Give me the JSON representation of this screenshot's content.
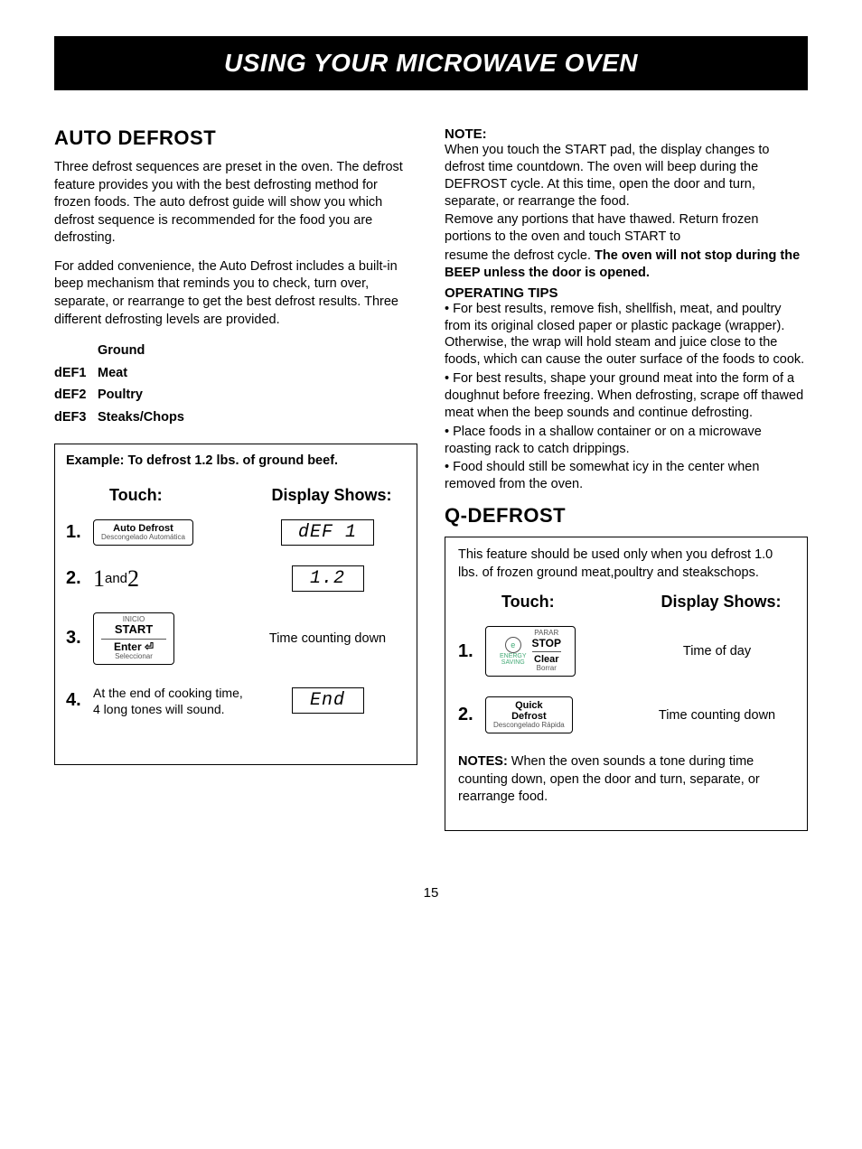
{
  "banner": "USING YOUR MICROWAVE OVEN",
  "left": {
    "h": "AUTO DEFROST",
    "p1": "Three defrost sequences are preset in the oven. The defrost feature provides you with the best defrosting method for frozen foods. The auto defrost guide will show you which defrost sequence is recommended for the food you are defrosting.",
    "p2": "For added convenience, the Auto Defrost includes a built-in beep mechanism that reminds you to check, turn over, separate, or rearrange to get the best defrost results. Three different defrosting levels are provided.",
    "def1c": "dEF1",
    "def1l": "Ground Meat",
    "def2c": "dEF2",
    "def2l": "Poultry",
    "def3c": "dEF3",
    "def3l": "Steaks/Chops",
    "example_title": "Example: To defrost 1.2 lbs. of ground beef.",
    "touch_h": "Touch:",
    "disp_h": "Display Shows:",
    "s1n": "1.",
    "s1_btn_main": "Auto Defrost",
    "s1_btn_sub": "Descongelado Automática",
    "s1_disp": "dEF 1",
    "s2n": "2.",
    "s2_touch_a": "1",
    "s2_touch_mid": " and ",
    "s2_touch_b": "2",
    "s2_disp": "1.2",
    "s3n": "3.",
    "s3_btn_top": "INICIO",
    "s3_btn_main": "START",
    "s3_btn_sub": "Enter ⏎",
    "s3_btn_tiny": "Seleccionar",
    "s3_disp": "Time counting down",
    "s4n": "4.",
    "s4_touch": "At the end of cooking time, 4 long tones will sound.",
    "s4_disp": "End"
  },
  "right": {
    "note_label": "NOTE:",
    "note1": "When you touch the START pad, the display changes to defrost time countdown. The oven will beep during the DEFROST cycle. At this time, open the door and turn, separate, or rearrange the food.",
    "note2": "Remove any portions that have thawed. Return frozen portions to the oven and touch START to",
    "note3a": "resume the defrost cycle. ",
    "note3b": "The oven will not stop during the BEEP unless the door is opened.",
    "tips_label": "OPERATING TIPS",
    "tip1": "• For best results, remove fish, shellfish, meat, and poultry from its original closed paper or plastic package (wrapper). Otherwise, the wrap will hold steam and juice close to the foods, which can cause the outer surface of the foods to cook.",
    "tip2": "• For best results, shape your ground meat into the form of a doughnut before freezing. When defrosting, scrape off thawed meat when the beep sounds and continue defrosting.",
    "tip3": "• Place foods in a shallow container or on a microwave roasting rack to catch drippings.",
    "tip4": "• Food should still be somewhat icy in the center when removed from the oven.",
    "qh": "Q-DEFROST",
    "qintro": "This feature should be used only when you defrost 1.0 lbs. of frozen ground meat,poultry and steakschops.",
    "qtouch_h": "Touch:",
    "qdisp_h": "Display Shows:",
    "qs1n": "1.",
    "qs1_top": "PARAR",
    "qs1_main": "STOP",
    "qs1_sub": "Clear",
    "qs1_tiny": "Borrar",
    "qs1_eco": "e",
    "qs1_energy1": "ENERGY",
    "qs1_energy2": "SAVING",
    "qs1_disp": "Time of day",
    "qs2n": "2.",
    "qs2_main1": "Quick",
    "qs2_main2": "Defrost",
    "qs2_sub": "Descongelado Rápida",
    "qs2_disp": "Time counting down",
    "qnotes_label": "NOTES:",
    "qnotes": " When the oven sounds a tone during time counting down, open the door and turn, separate, or rearrange food."
  },
  "page": "15"
}
